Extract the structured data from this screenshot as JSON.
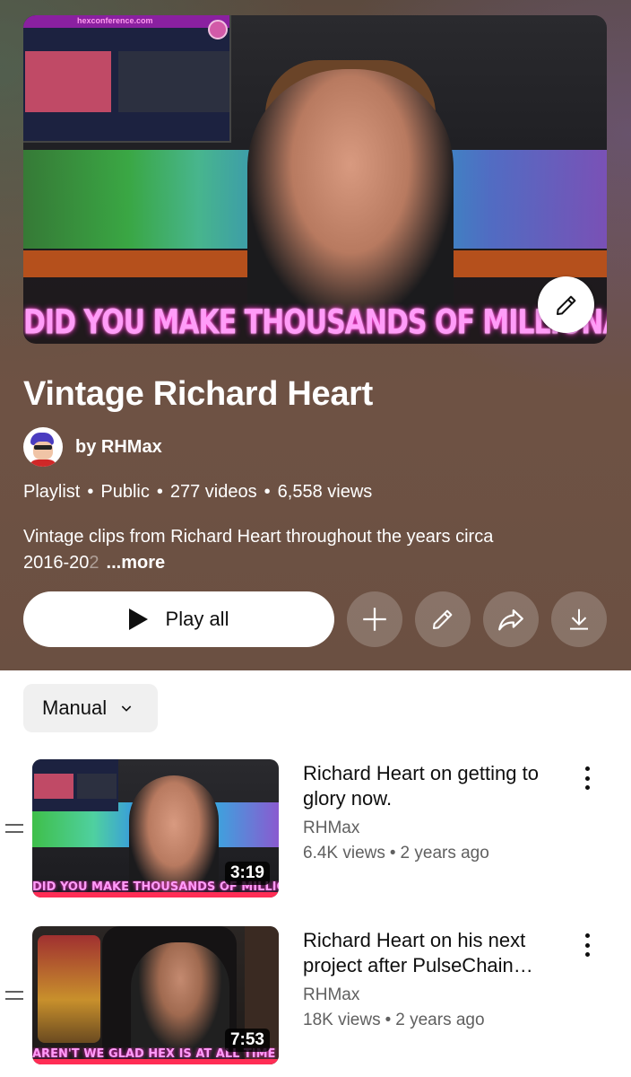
{
  "playlist": {
    "hero_caption": "DID YOU MAKE THOUSANDS OF MILLIONAIRES?",
    "hero_site": "hexconference.com",
    "title": "Vintage Richard Heart",
    "owner": "by RHMax",
    "meta": {
      "type": "Playlist",
      "visibility": "Public",
      "count": "277 videos",
      "views": "6,558 views"
    },
    "description": {
      "line1": "Vintage clips from Richard Heart throughout the years circa",
      "line2": "2016-20",
      "line2_fade": "2",
      "more": "...more"
    }
  },
  "actions": {
    "play_all": "Play all",
    "icons": [
      "plus-icon",
      "pencil-icon",
      "share-icon",
      "download-icon"
    ]
  },
  "sort": {
    "label": "Manual"
  },
  "videos": [
    {
      "title": "Richard Heart on getting to glory now.",
      "channel": "RHMax",
      "views": "6.4K views",
      "age": "2 years ago",
      "duration": "3:19",
      "thumb_caption": "DID YOU MAKE THOUSANDS OF MILLIONAIRES?"
    },
    {
      "title": "Richard Heart on his next project after PulseChain…",
      "channel": "RHMax",
      "views": "18K views",
      "age": "2 years ago",
      "duration": "7:53",
      "thumb_caption": "AREN'T WE GLAD HEX IS AT ALL TIME HIGHS"
    }
  ],
  "colors": {
    "header_bg": "#6b5042",
    "accent": "#ff2d55",
    "caption": "#ff9cf8"
  }
}
